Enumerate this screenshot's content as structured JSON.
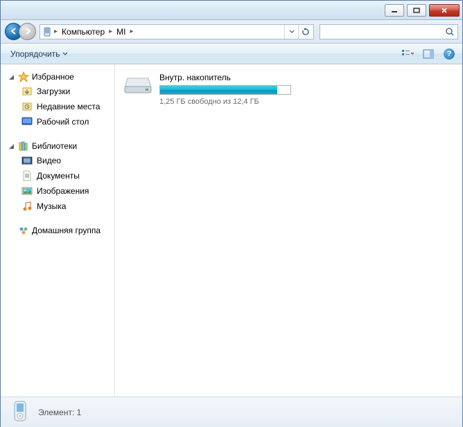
{
  "breadcrumb": {
    "items": [
      "Компьютер",
      "MI"
    ]
  },
  "toolbar": {
    "organize": "Упорядочить"
  },
  "sidebar": {
    "favorites": {
      "label": "Избранное",
      "items": [
        "Загрузки",
        "Недавние места",
        "Рабочий стол"
      ]
    },
    "libraries": {
      "label": "Библиотеки",
      "items": [
        "Видео",
        "Документы",
        "Изображения",
        "Музыка"
      ]
    },
    "homegroup": {
      "label": "Домашняя группа"
    }
  },
  "storage": {
    "name": "Внутр. накопитель",
    "free_text": "1,25 ГБ свободно из 12,4 ГБ",
    "used_percent": 90
  },
  "status": {
    "text": "Элемент: 1"
  }
}
